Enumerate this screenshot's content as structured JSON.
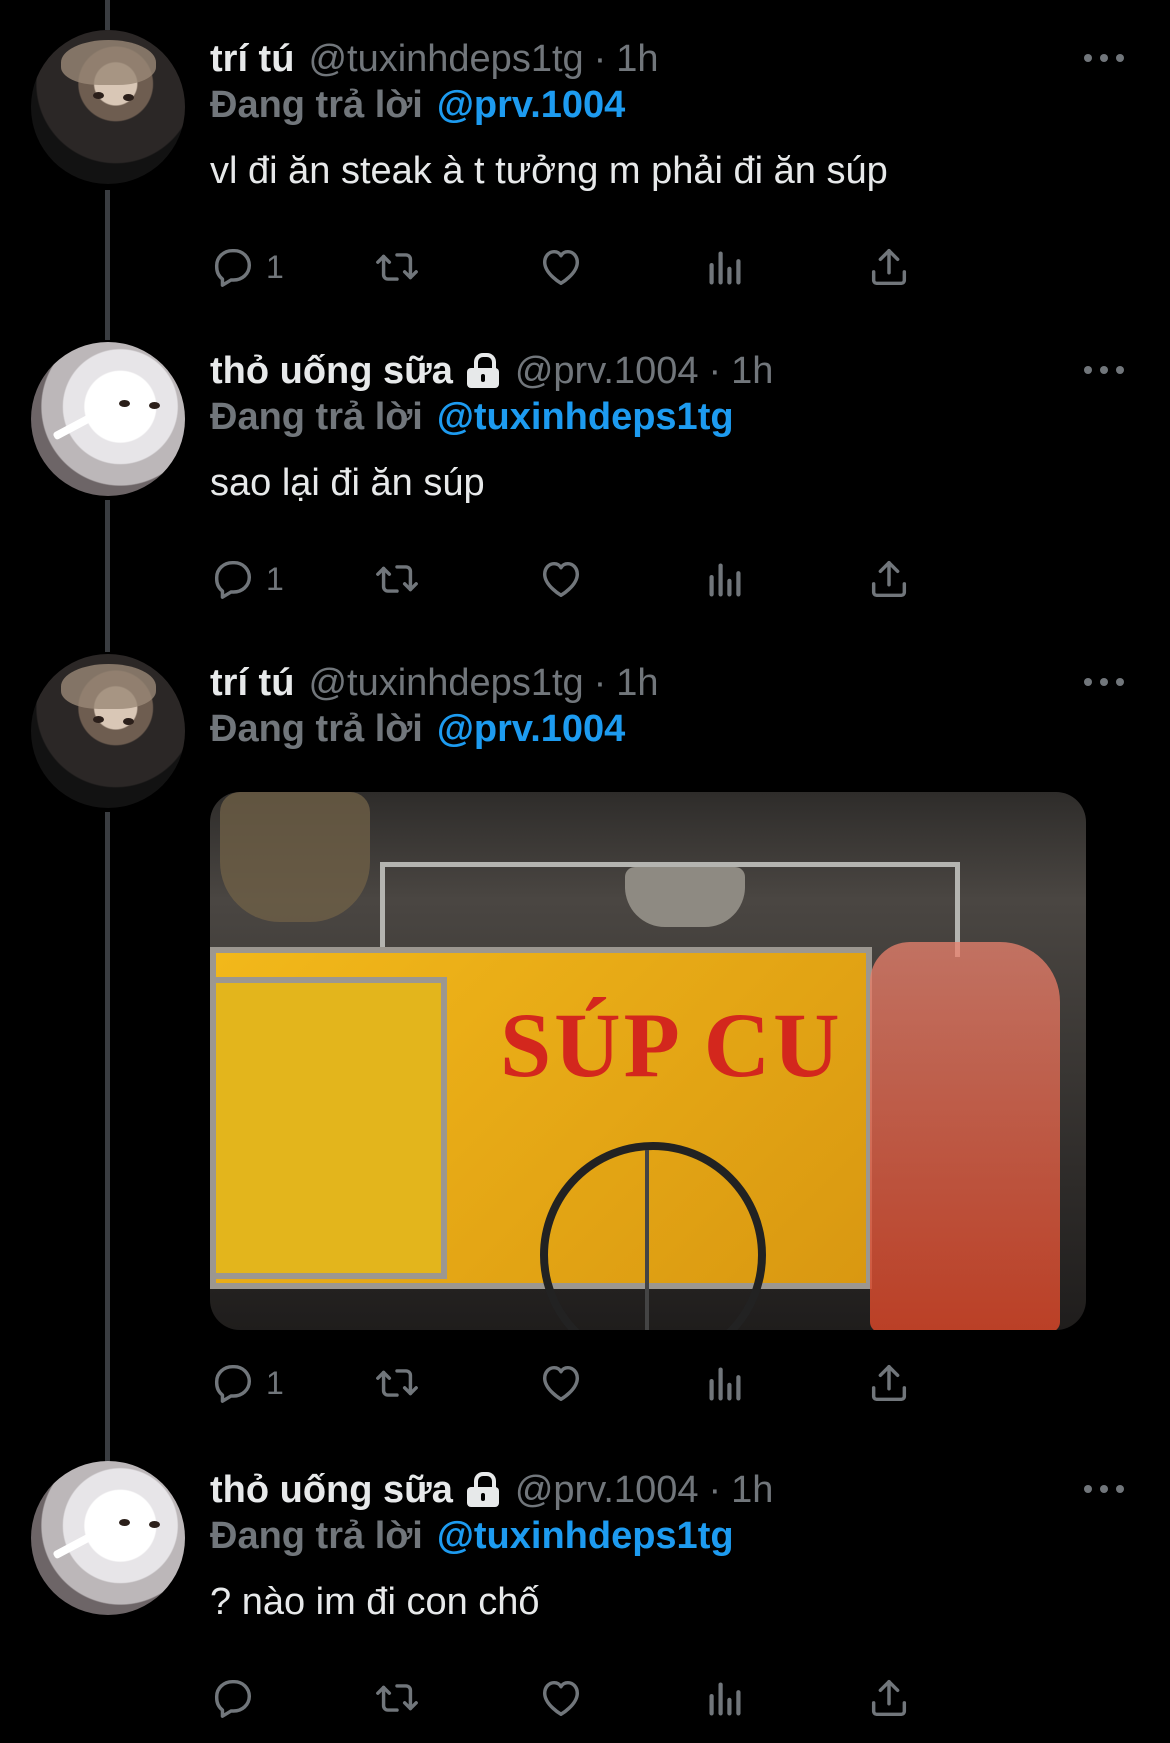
{
  "tweets": [
    {
      "name": "trí tú",
      "handle": "@tuxinhdeps1tg",
      "dot": "·",
      "time": "1h",
      "replying_label": "Đang trả lời",
      "replying_to": "@prv.1004",
      "text": "vl đi ăn steak à t tưởng m phải đi ăn súp",
      "reply_count": "1",
      "locked": false,
      "avatar": "trí tú profile photo"
    },
    {
      "name": "thỏ uống sữa",
      "handle": "@prv.1004",
      "dot": "·",
      "time": "1h",
      "replying_label": "Đang trả lời",
      "replying_to": "@tuxinhdeps1tg",
      "text": "sao lại đi ăn súp",
      "reply_count": "1",
      "locked": true,
      "avatar": "white cat photo"
    },
    {
      "name": "trí tú",
      "handle": "@tuxinhdeps1tg",
      "dot": "·",
      "time": "1h",
      "replying_label": "Đang trả lời",
      "replying_to": "@prv.1004",
      "text": "",
      "media_sign_text": "SÚP CU",
      "reply_count": "1",
      "locked": false,
      "avatar": "trí tú profile photo"
    },
    {
      "name": "thỏ uống sữa",
      "handle": "@prv.1004",
      "dot": "·",
      "time": "1h",
      "replying_label": "Đang trả lời",
      "replying_to": "@tuxinhdeps1tg",
      "text": "? nào im đi con chố",
      "reply_count": "",
      "locked": true,
      "avatar": "white cat photo"
    }
  ],
  "icons": {
    "reply": "reply-icon",
    "retweet": "retweet-icon",
    "like": "like-icon",
    "views": "views-icon",
    "share": "share-icon",
    "more": "more-icon",
    "lock": "lock-icon"
  },
  "colors": {
    "background": "#000000",
    "text": "#e7e9ea",
    "secondary": "#71767b",
    "mention": "#1d9bf0",
    "thread_line": "#3a3d41"
  }
}
